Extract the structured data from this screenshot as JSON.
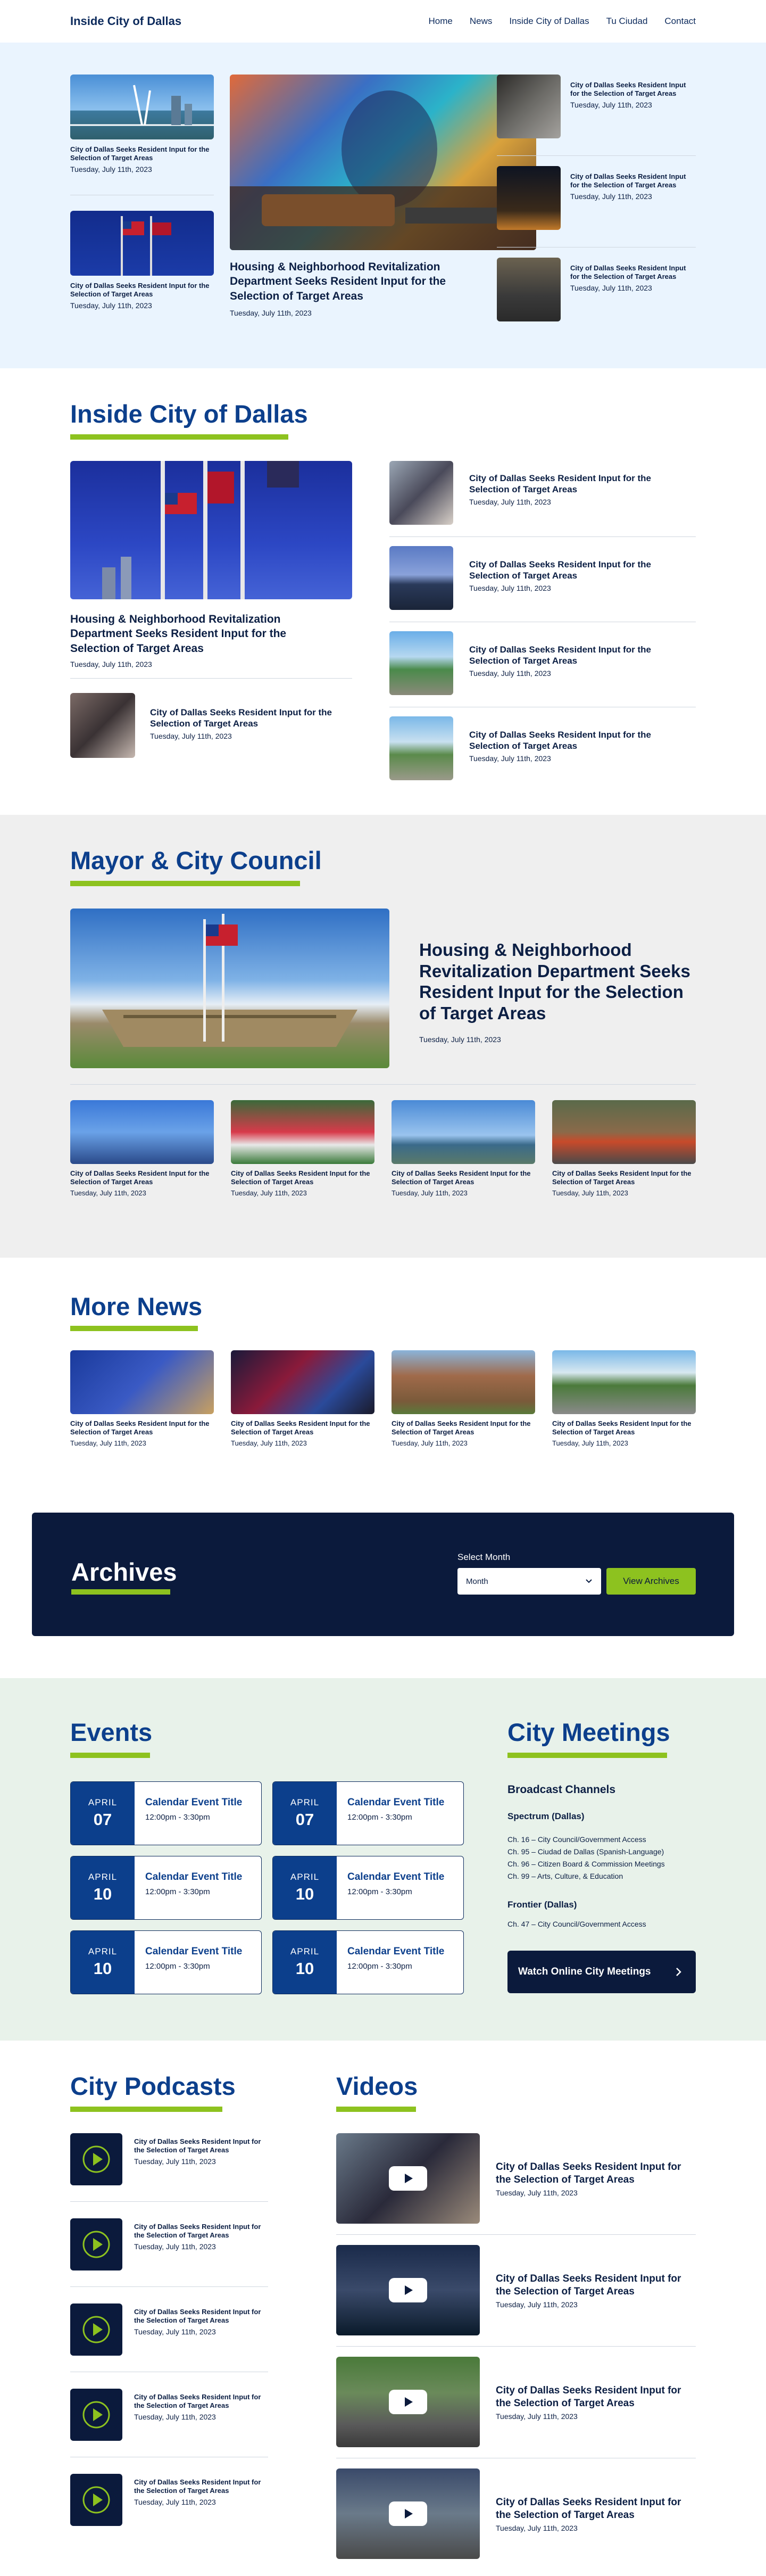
{
  "header": {
    "logo": "Inside City of Dallas",
    "nav": [
      "Home",
      "News",
      "Inside City of Dallas",
      "Tu Ciudad",
      "Contact"
    ]
  },
  "common": {
    "short_title": "City of Dallas Seeks Resident Input for the Selection of Target Areas",
    "long_title": "Housing & Neighborhood Revitalization Department Seeks Resident Input for the Selection of Target Areas",
    "date": "Tuesday, July 11th, 2023"
  },
  "sections": {
    "inside": "Inside City of Dallas",
    "mayor": "Mayor & City Council",
    "more": "More News",
    "archives": "Archives",
    "events": "Events",
    "meetings": "City Meetings",
    "podcasts": "City Podcasts",
    "videos": "Videos"
  },
  "archives": {
    "select_label": "Select Month",
    "select_value": "Month",
    "button": "View Archives"
  },
  "events": [
    {
      "month": "APRIL",
      "day": "07",
      "title": "Calendar Event Title",
      "time": "12:00pm - 3:30pm"
    },
    {
      "month": "APRIL",
      "day": "07",
      "title": "Calendar Event Title",
      "time": "12:00pm - 3:30pm"
    },
    {
      "month": "APRIL",
      "day": "10",
      "title": "Calendar Event Title",
      "time": "12:00pm - 3:30pm"
    },
    {
      "month": "APRIL",
      "day": "10",
      "title": "Calendar Event Title",
      "time": "12:00pm - 3:30pm"
    },
    {
      "month": "APRIL",
      "day": "10",
      "title": "Calendar Event Title",
      "time": "12:00pm - 3:30pm"
    },
    {
      "month": "APRIL",
      "day": "10",
      "title": "Calendar Event Title",
      "time": "12:00pm - 3:30pm"
    }
  ],
  "meetings": {
    "broadcast_heading": "Broadcast Channels",
    "group1": "Spectrum (Dallas)",
    "channels1": [
      "Ch. 16 – City Council/Government Access",
      "Ch. 95 – Ciudad de Dallas (Spanish-Language)",
      "Ch. 96 – Citizen Board & Commission Meetings",
      "Ch. 99 – Arts, Culture, & Education"
    ],
    "group2": "Frontier (Dallas)",
    "channels2": [
      "Ch. 47 – City Council/Government Access"
    ],
    "watch_button": "Watch Online City Meetings"
  },
  "colors": {
    "navy": "#0b1a3c",
    "blue": "#0c3f8c",
    "green": "#8dc21f",
    "hero_bg": "#eaf4fe",
    "gray_bg": "#efefef",
    "events_bg": "#e8f2ea"
  },
  "icons": {
    "play": "play-icon",
    "podcast": "podcast-play-icon",
    "chevron": "chevron-down-icon",
    "arrow": "chevron-right-icon"
  }
}
